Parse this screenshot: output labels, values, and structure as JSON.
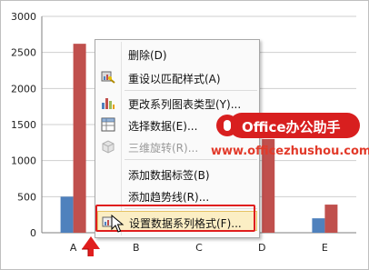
{
  "chart_data": {
    "type": "bar",
    "categories": [
      "A",
      "B",
      "C",
      "D",
      "E"
    ],
    "series": [
      {
        "values": [
          500,
          null,
          null,
          null,
          200
        ]
      },
      {
        "values": [
          2620,
          null,
          null,
          1300,
          390
        ]
      }
    ],
    "line_markers_visible": true,
    "y_ticks": [
      "0",
      "500",
      "1000",
      "1500",
      "2000",
      "2500",
      "3000"
    ],
    "ylim": [
      0,
      3000
    ],
    "grid": true,
    "colors": {
      "series1": "#4f81bd",
      "series2": "#c0504d",
      "markers": "#4f81bd"
    }
  },
  "context_menu": {
    "items": [
      {
        "label": "删除(D)",
        "icon": "none",
        "enabled": true
      },
      {
        "label": "重设以匹配样式(A)",
        "icon": "reset-style-icon",
        "enabled": true
      },
      {
        "label": "更改系列图表类型(Y)...",
        "icon": "chart-type-icon",
        "enabled": true
      },
      {
        "label": "选择数据(E)...",
        "icon": "select-data-icon",
        "enabled": true
      },
      {
        "label": "三维旋转(R)...",
        "icon": "3d-rotation-icon",
        "enabled": false
      },
      {
        "label": "添加数据标签(B)",
        "icon": "none",
        "enabled": true
      },
      {
        "label": "添加趋势线(R)...",
        "icon": "none",
        "enabled": true
      },
      {
        "label": "设置数据系列格式(F)...",
        "icon": "format-series-icon",
        "enabled": true,
        "active": true
      }
    ]
  },
  "watermark": {
    "brand": "Office办公助手",
    "url": "www.officezhushou.com",
    "color": "#d81f1f"
  }
}
